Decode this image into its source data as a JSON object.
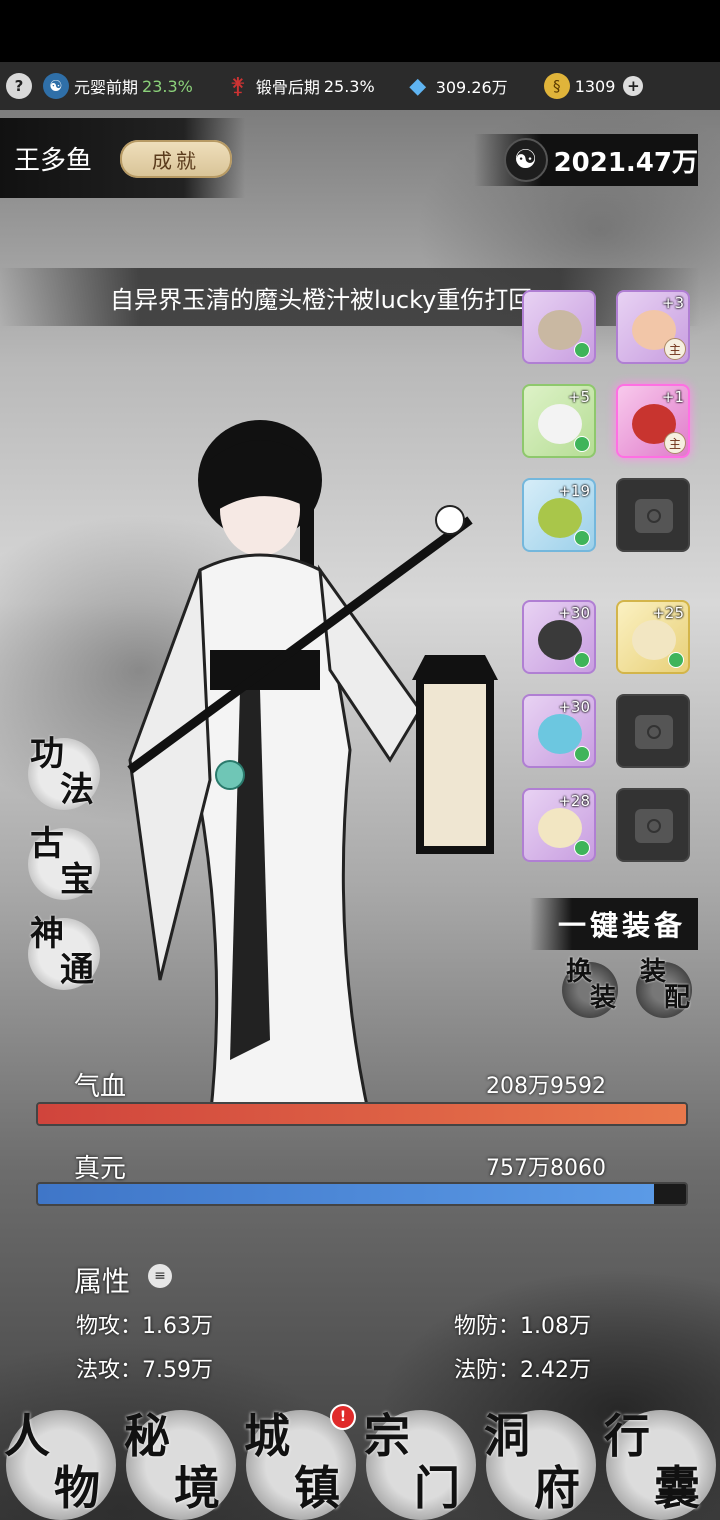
{
  "resources": {
    "realm1": {
      "label": "元婴前期",
      "pct": "23.3%"
    },
    "realm2": {
      "label": "锻骨后期",
      "pct": "25.3%"
    },
    "spirit_stones": "309.26万",
    "gold": "1309"
  },
  "player": {
    "name": "王多鱼",
    "achievement_label": "成就",
    "power": "2021.47万"
  },
  "news": "自异界玉清的魔头橙汁被lucky重伤打回,",
  "equipment": [
    {
      "level": "",
      "rarity": "purple",
      "icon": "fan-icon"
    },
    {
      "level": "+3",
      "rarity": "purple",
      "icon": "lotus-icon",
      "main": "主"
    },
    {
      "level": "+5",
      "rarity": "green",
      "icon": "robe-icon"
    },
    {
      "level": "+1",
      "rarity": "pink",
      "icon": "cauldron-icon",
      "main": "主"
    },
    {
      "level": "+19",
      "rarity": "blue",
      "icon": "jade-pendant-icon"
    },
    {
      "level": "",
      "rarity": "empty",
      "icon": "locked-slot-icon"
    },
    {
      "level": "+30",
      "rarity": "purple",
      "icon": "prayer-beads-icon"
    },
    {
      "level": "+25",
      "rarity": "gold",
      "icon": "scroll-icon"
    },
    {
      "level": "+30",
      "rarity": "purple",
      "icon": "altar-icon"
    },
    {
      "level": "",
      "rarity": "empty",
      "icon": "locked-slot-icon"
    },
    {
      "level": "+28",
      "rarity": "purple",
      "icon": "scroll-icon"
    },
    {
      "level": "",
      "rarity": "empty",
      "icon": "locked-slot-icon"
    }
  ],
  "skills": [
    {
      "a": "功",
      "b": "法"
    },
    {
      "a": "古",
      "b": "宝"
    },
    {
      "a": "神",
      "b": "通"
    }
  ],
  "one_key_equip": "一键装备",
  "swap": {
    "a": "换",
    "b": "装"
  },
  "config": {
    "a": "装",
    "b": "配"
  },
  "stats": {
    "hp": {
      "label": "气血",
      "value": "208万9592",
      "fill": 1.0,
      "color": "#d0443c"
    },
    "mp": {
      "label": "真元",
      "value": "757万8060",
      "fill": 0.95,
      "color": "#3f76c8"
    }
  },
  "attributes": {
    "title": "属性",
    "phys_atk": "物攻：1.63万",
    "phys_def": "物防：1.08万",
    "mag_atk": "法攻：7.59万",
    "mag_def": "法防：2.42万"
  },
  "nav": [
    {
      "a": "人",
      "b": "物"
    },
    {
      "a": "秘",
      "b": "境"
    },
    {
      "a": "城",
      "b": "镇",
      "badge": "!"
    },
    {
      "a": "宗",
      "b": "门"
    },
    {
      "a": "洞",
      "b": "府"
    },
    {
      "a": "行",
      "b": "囊"
    }
  ],
  "colors": {
    "accent_green": "#8bd17a",
    "hp": "#d0443c",
    "mp": "#3f76c8"
  }
}
